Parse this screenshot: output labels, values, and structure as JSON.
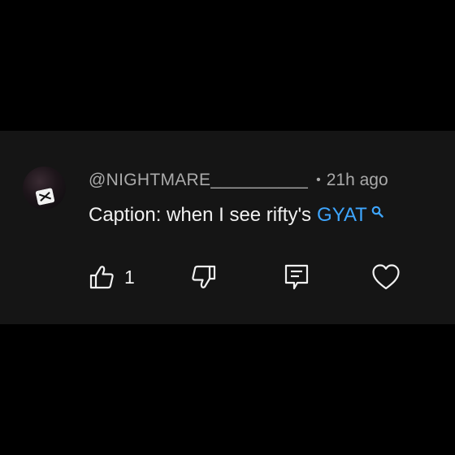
{
  "comment": {
    "username": "@NIGHTMARE__________",
    "separator": "•",
    "timestamp": "21h ago",
    "text": "Caption: when I see rifty's",
    "hashtag": "GYAT",
    "hashtag_color": "#3ea6ff",
    "avatar_icon": "capcut-logo-icon"
  },
  "actions": {
    "like_icon": "thumbs-up-icon",
    "like_count": "1",
    "dislike_icon": "thumbs-down-icon",
    "reply_icon": "reply-icon",
    "heart_icon": "heart-icon"
  },
  "colors": {
    "background": "#000000",
    "card": "#151515",
    "text_primary": "#f1f1f1",
    "text_secondary": "#aaaaaa",
    "link": "#3ea6ff"
  }
}
